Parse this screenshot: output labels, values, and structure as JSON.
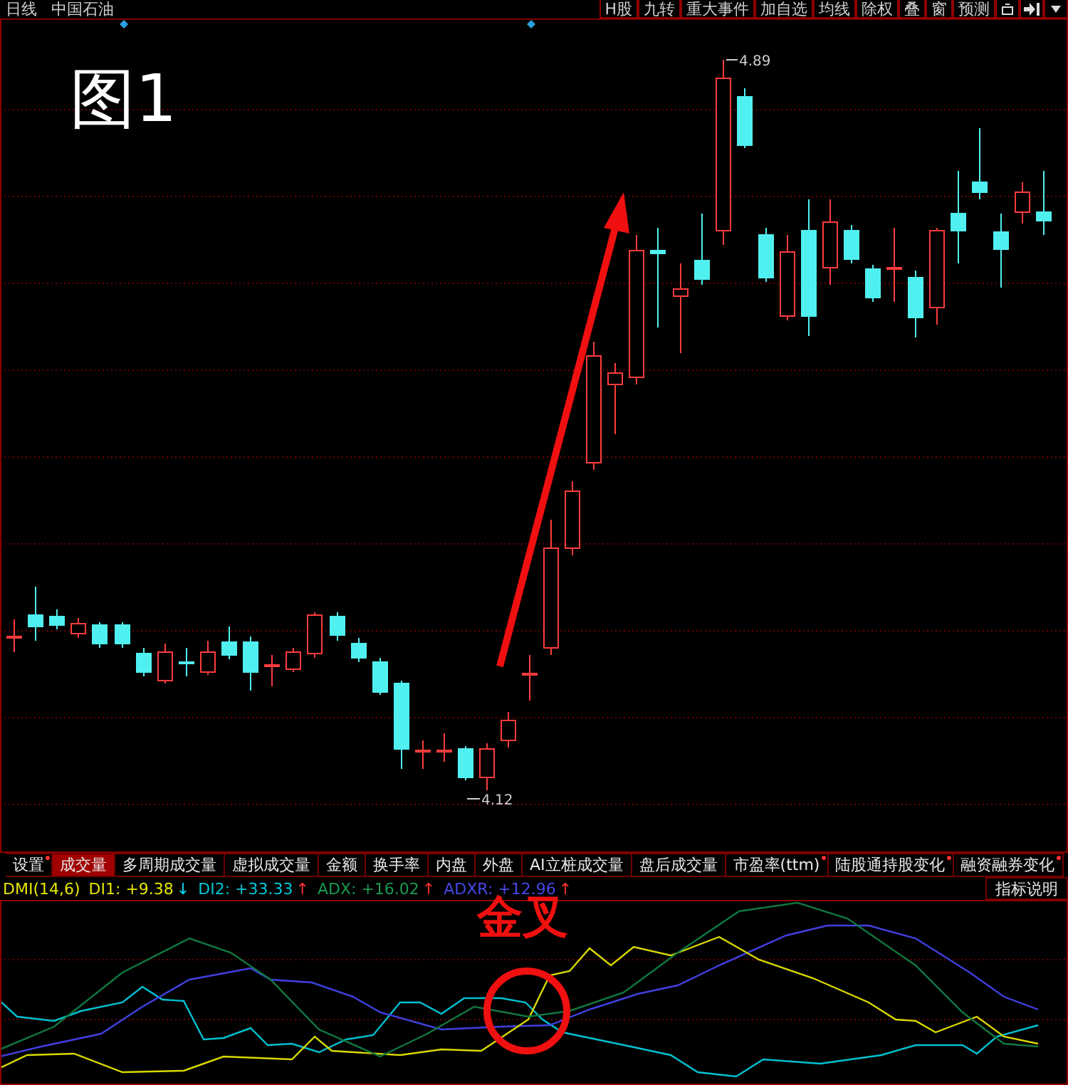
{
  "topbar": {
    "period": "日线",
    "stock": "中国石油",
    "buttons": [
      "H股",
      "九转",
      "重大事件",
      "加自选",
      "均线",
      "除权",
      "叠",
      "窗",
      "预测"
    ]
  },
  "chart": {
    "title": "图1",
    "high_label": "4.89",
    "low_label": "4.12"
  },
  "tabs": [
    {
      "label": "设置",
      "selected": false,
      "dot": true
    },
    {
      "label": "成交量",
      "selected": true,
      "dot": false
    },
    {
      "label": "多周期成交量",
      "selected": false,
      "dot": false
    },
    {
      "label": "虚拟成交量",
      "selected": false,
      "dot": false
    },
    {
      "label": "金额",
      "selected": false,
      "dot": false
    },
    {
      "label": "换手率",
      "selected": false,
      "dot": false
    },
    {
      "label": "内盘",
      "selected": false,
      "dot": false
    },
    {
      "label": "外盘",
      "selected": false,
      "dot": false
    },
    {
      "label": "AI立桩成交量",
      "selected": false,
      "dot": false
    },
    {
      "label": "盘后成交量",
      "selected": false,
      "dot": false
    },
    {
      "label": "市盈率(ttm)",
      "selected": false,
      "dot": true
    },
    {
      "label": "陆股通持股变化",
      "selected": false,
      "dot": true
    },
    {
      "label": "融资融券变化",
      "selected": false,
      "dot": true
    }
  ],
  "indicator": {
    "name": "DMI(14,6)",
    "values": [
      {
        "kind": "value",
        "text": "DI1: +9.38",
        "color": "#e6e600"
      },
      {
        "kind": "arrow",
        "text": "↓",
        "color": "#00e0ff"
      },
      {
        "kind": "value",
        "text": "DI2: +33.33",
        "color": "#00c8d8"
      },
      {
        "kind": "arrow",
        "text": "↑",
        "color": "#ff3030"
      },
      {
        "kind": "value",
        "text": "ADX: +16.02",
        "color": "#1a9a50"
      },
      {
        "kind": "arrow",
        "text": "↑",
        "color": "#ff3030"
      },
      {
        "kind": "value",
        "text": "ADXR: +12.96",
        "color": "#4848e8"
      },
      {
        "kind": "arrow",
        "text": "↑",
        "color": "#ff3030"
      }
    ],
    "help_button": "指标说明",
    "annotation": "金叉"
  }
}
